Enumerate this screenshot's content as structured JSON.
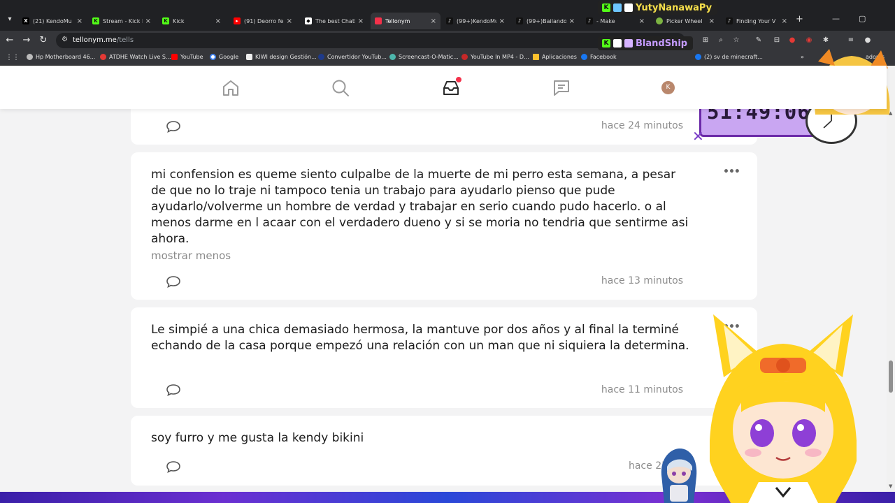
{
  "browser": {
    "tabs": [
      {
        "title": "(21) KendoMu",
        "favicon": "x-logo",
        "color": "#000000",
        "active": false
      },
      {
        "title": "Stream - Kick D",
        "favicon": "kick-logo",
        "color": "#53fc18",
        "active": false
      },
      {
        "title": "Kick",
        "favicon": "kick-logo",
        "color": "#53fc18",
        "active": false
      },
      {
        "title": "(91) Deorro fe",
        "favicon": "youtube-logo",
        "color": "#ff0000",
        "active": false
      },
      {
        "title": "The best Chatb",
        "favicon": "chatbot-logo",
        "color": "#ffffff",
        "active": false
      },
      {
        "title": "Tellonym",
        "favicon": "tellonym-logo",
        "color": "#f4314a",
        "active": true
      },
      {
        "title": "(99+)KendoMu",
        "favicon": "tiktok-logo",
        "color": "#111111",
        "active": false
      },
      {
        "title": "(99+)Bailando",
        "favicon": "tiktok-logo",
        "color": "#111111",
        "active": false
      },
      {
        "title": "- Make",
        "favicon": "tiktok-logo",
        "color": "#111111",
        "active": false
      },
      {
        "title": "Picker Wheel",
        "favicon": "wheel-logo",
        "color": "#7cb342",
        "active": false
      },
      {
        "title": "Finding Your V",
        "favicon": "tiktok-logo",
        "color": "#111111",
        "active": false
      }
    ],
    "url_host": "tellonym.me",
    "url_path": "/tells",
    "bookmarks": [
      {
        "label": "Hp Motherboard 46...",
        "color": "#bbbbbb"
      },
      {
        "label": "ATDHE Watch Live S...",
        "color": "#e53935"
      },
      {
        "label": "YouTube",
        "color": "#ff0000"
      },
      {
        "label": "Google",
        "color": "#4285f4"
      },
      {
        "label": "KIWI design Gestión...",
        "color": "#eeeeee"
      },
      {
        "label": "Convertidor YouTub...",
        "color": "#1e3a8a"
      },
      {
        "label": "Screencast-O-Matic...",
        "color": "#4db6ac"
      },
      {
        "label": "YouTube In MP4 - D...",
        "color": "#c62828"
      },
      {
        "label": "Aplicaciones",
        "color": "#fbc02d"
      },
      {
        "label": "Facebook",
        "color": "#1877f2"
      },
      {
        "label": "(2) sv de minecraft...",
        "color": "#1877f2"
      },
      {
        "label": "adores",
        "color": "#ffffff"
      }
    ]
  },
  "overlay": {
    "viewer_1": "YutyNanawaPy",
    "viewer_2": "BlandShip",
    "timer": "51:49:06"
  },
  "app": {
    "nav": [
      "home-icon",
      "search-icon",
      "inbox-icon",
      "feed-icon",
      "profile-avatar"
    ],
    "avatar_letter": "K",
    "accent": "#f4314a"
  },
  "cards": [
    {
      "text": "",
      "show_less": "",
      "time": "hace 24 minutos"
    },
    {
      "text": "mi confension es queme siento culpalbe  de la muerte de mi perro esta semana, a pesar de que no lo traje ni tampoco tenia un trabajo para ayudarlo pienso que pude ayudarlo/volverme un hombre de verdad y trabajar en serio cuando pudo hacerlo. o al menos darme en l acaar con el verdadero dueno y si se moria no tendria que sentirme asi ahora.",
      "show_less": "mostrar menos",
      "time": "hace 13 minutos"
    },
    {
      "text": "Le simpié a una chica demasiado hermosa, la mantuve por dos años y al final la terminé echando de la casa porque empezó una relación con un man que ni siquiera la determina.",
      "show_less": "",
      "time": "hace 11 minutos"
    },
    {
      "text": "soy furro y me gusta la kendy bikini",
      "show_less": "",
      "time": "hace 25 mi"
    }
  ]
}
